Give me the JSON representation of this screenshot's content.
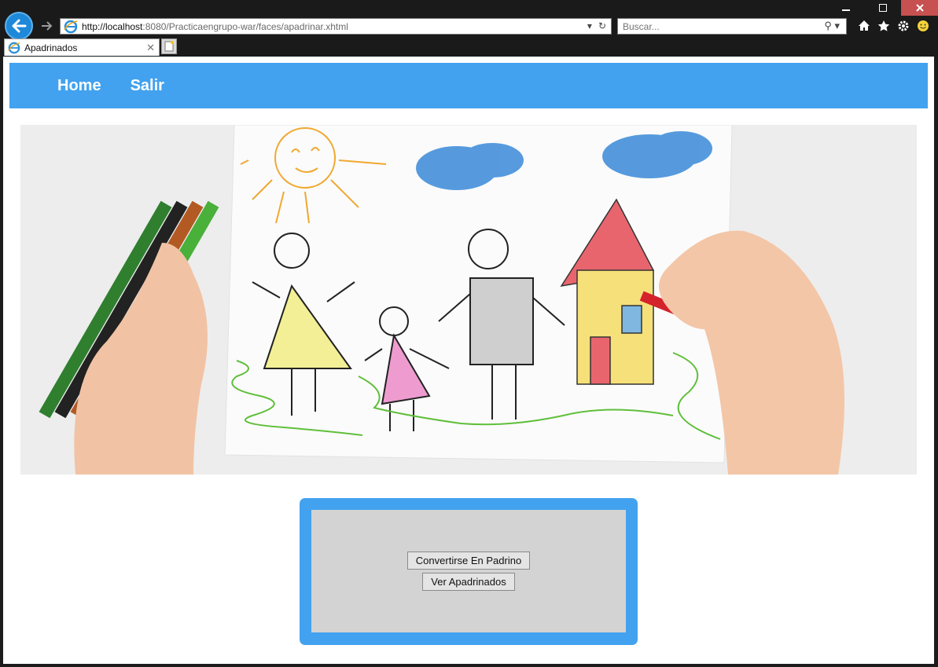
{
  "browser": {
    "url_host": "http://localhost",
    "url_path": ":8080/Practicaengrupo-war/faces/apadrinar.xhtml",
    "search_placeholder": "Buscar...",
    "tab_title": "Apadrinados",
    "accent": "#1e88d9"
  },
  "nav": {
    "home_label": "Home",
    "salir_label": "Salir",
    "bar_color": "#42a2ef"
  },
  "panel": {
    "convertirse_label": "Convertirse En Padrino",
    "ver_label": "Ver Apadrinados"
  }
}
